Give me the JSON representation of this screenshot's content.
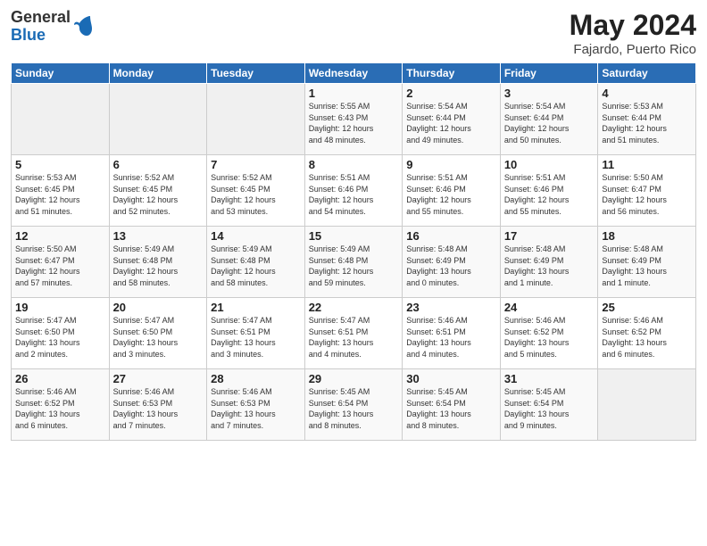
{
  "logo": {
    "general": "General",
    "blue": "Blue"
  },
  "title": {
    "month_year": "May 2024",
    "location": "Fajardo, Puerto Rico"
  },
  "headers": [
    "Sunday",
    "Monday",
    "Tuesday",
    "Wednesday",
    "Thursday",
    "Friday",
    "Saturday"
  ],
  "weeks": [
    [
      {
        "day": "",
        "info": ""
      },
      {
        "day": "",
        "info": ""
      },
      {
        "day": "",
        "info": ""
      },
      {
        "day": "1",
        "info": "Sunrise: 5:55 AM\nSunset: 6:43 PM\nDaylight: 12 hours\nand 48 minutes."
      },
      {
        "day": "2",
        "info": "Sunrise: 5:54 AM\nSunset: 6:44 PM\nDaylight: 12 hours\nand 49 minutes."
      },
      {
        "day": "3",
        "info": "Sunrise: 5:54 AM\nSunset: 6:44 PM\nDaylight: 12 hours\nand 50 minutes."
      },
      {
        "day": "4",
        "info": "Sunrise: 5:53 AM\nSunset: 6:44 PM\nDaylight: 12 hours\nand 51 minutes."
      }
    ],
    [
      {
        "day": "5",
        "info": "Sunrise: 5:53 AM\nSunset: 6:45 PM\nDaylight: 12 hours\nand 51 minutes."
      },
      {
        "day": "6",
        "info": "Sunrise: 5:52 AM\nSunset: 6:45 PM\nDaylight: 12 hours\nand 52 minutes."
      },
      {
        "day": "7",
        "info": "Sunrise: 5:52 AM\nSunset: 6:45 PM\nDaylight: 12 hours\nand 53 minutes."
      },
      {
        "day": "8",
        "info": "Sunrise: 5:51 AM\nSunset: 6:46 PM\nDaylight: 12 hours\nand 54 minutes."
      },
      {
        "day": "9",
        "info": "Sunrise: 5:51 AM\nSunset: 6:46 PM\nDaylight: 12 hours\nand 55 minutes."
      },
      {
        "day": "10",
        "info": "Sunrise: 5:51 AM\nSunset: 6:46 PM\nDaylight: 12 hours\nand 55 minutes."
      },
      {
        "day": "11",
        "info": "Sunrise: 5:50 AM\nSunset: 6:47 PM\nDaylight: 12 hours\nand 56 minutes."
      }
    ],
    [
      {
        "day": "12",
        "info": "Sunrise: 5:50 AM\nSunset: 6:47 PM\nDaylight: 12 hours\nand 57 minutes."
      },
      {
        "day": "13",
        "info": "Sunrise: 5:49 AM\nSunset: 6:48 PM\nDaylight: 12 hours\nand 58 minutes."
      },
      {
        "day": "14",
        "info": "Sunrise: 5:49 AM\nSunset: 6:48 PM\nDaylight: 12 hours\nand 58 minutes."
      },
      {
        "day": "15",
        "info": "Sunrise: 5:49 AM\nSunset: 6:48 PM\nDaylight: 12 hours\nand 59 minutes."
      },
      {
        "day": "16",
        "info": "Sunrise: 5:48 AM\nSunset: 6:49 PM\nDaylight: 13 hours\nand 0 minutes."
      },
      {
        "day": "17",
        "info": "Sunrise: 5:48 AM\nSunset: 6:49 PM\nDaylight: 13 hours\nand 1 minute."
      },
      {
        "day": "18",
        "info": "Sunrise: 5:48 AM\nSunset: 6:49 PM\nDaylight: 13 hours\nand 1 minute."
      }
    ],
    [
      {
        "day": "19",
        "info": "Sunrise: 5:47 AM\nSunset: 6:50 PM\nDaylight: 13 hours\nand 2 minutes."
      },
      {
        "day": "20",
        "info": "Sunrise: 5:47 AM\nSunset: 6:50 PM\nDaylight: 13 hours\nand 3 minutes."
      },
      {
        "day": "21",
        "info": "Sunrise: 5:47 AM\nSunset: 6:51 PM\nDaylight: 13 hours\nand 3 minutes."
      },
      {
        "day": "22",
        "info": "Sunrise: 5:47 AM\nSunset: 6:51 PM\nDaylight: 13 hours\nand 4 minutes."
      },
      {
        "day": "23",
        "info": "Sunrise: 5:46 AM\nSunset: 6:51 PM\nDaylight: 13 hours\nand 4 minutes."
      },
      {
        "day": "24",
        "info": "Sunrise: 5:46 AM\nSunset: 6:52 PM\nDaylight: 13 hours\nand 5 minutes."
      },
      {
        "day": "25",
        "info": "Sunrise: 5:46 AM\nSunset: 6:52 PM\nDaylight: 13 hours\nand 6 minutes."
      }
    ],
    [
      {
        "day": "26",
        "info": "Sunrise: 5:46 AM\nSunset: 6:52 PM\nDaylight: 13 hours\nand 6 minutes."
      },
      {
        "day": "27",
        "info": "Sunrise: 5:46 AM\nSunset: 6:53 PM\nDaylight: 13 hours\nand 7 minutes."
      },
      {
        "day": "28",
        "info": "Sunrise: 5:46 AM\nSunset: 6:53 PM\nDaylight: 13 hours\nand 7 minutes."
      },
      {
        "day": "29",
        "info": "Sunrise: 5:45 AM\nSunset: 6:54 PM\nDaylight: 13 hours\nand 8 minutes."
      },
      {
        "day": "30",
        "info": "Sunrise: 5:45 AM\nSunset: 6:54 PM\nDaylight: 13 hours\nand 8 minutes."
      },
      {
        "day": "31",
        "info": "Sunrise: 5:45 AM\nSunset: 6:54 PM\nDaylight: 13 hours\nand 9 minutes."
      },
      {
        "day": "",
        "info": ""
      }
    ]
  ]
}
